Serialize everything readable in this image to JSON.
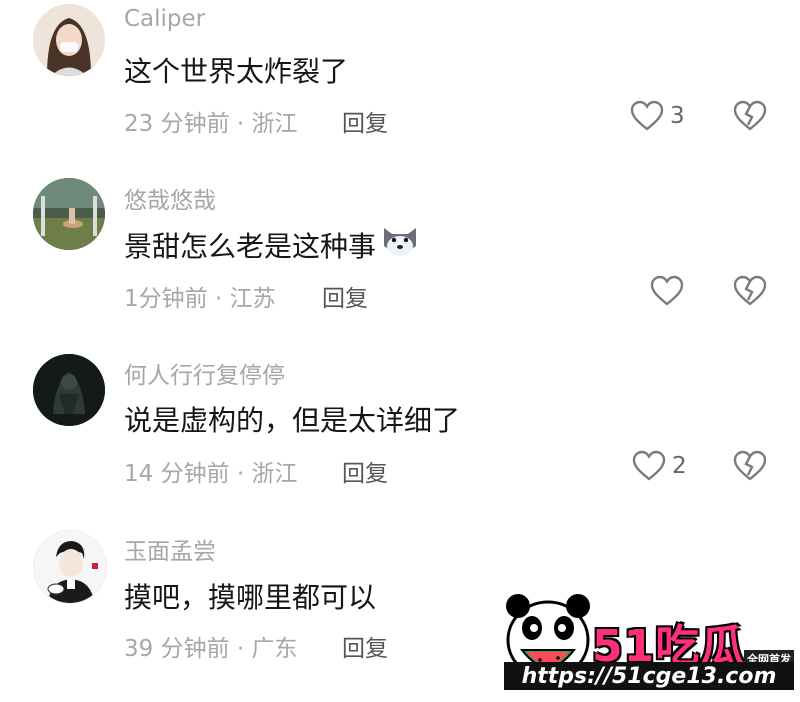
{
  "comments": [
    {
      "username": "Caliper",
      "text": "这个世界太炸裂了",
      "meta": "23 分钟前 · 浙江",
      "reply": "回复",
      "likes": "3",
      "avatar": "avatar-woman"
    },
    {
      "username": "悠哉悠哉",
      "text": "景甜怎么老是这种事",
      "meta": "1分钟前 · 江苏",
      "reply": "回复",
      "likes": "",
      "avatar": "avatar-scene",
      "emoji": "husky-emoji"
    },
    {
      "username": "何人行行复停停",
      "text": "说是虚构的，但是太详细了",
      "meta": "14 分钟前 · 浙江",
      "reply": "回复",
      "likes": "2",
      "avatar": "avatar-dark"
    },
    {
      "username": "玉面孟尝",
      "text": "摸吧，摸哪里都可以",
      "meta": "39 分钟前 · 广东",
      "reply": "回复",
      "likes": "",
      "avatar": "avatar-cartoon"
    }
  ],
  "watermark": {
    "title": "51吃瓜",
    "tag": "全网首发",
    "url": "https://51cge13.com"
  },
  "colors": {
    "muted": "#a6a6ab",
    "text": "#161616",
    "brand": "#ff2f7d"
  }
}
